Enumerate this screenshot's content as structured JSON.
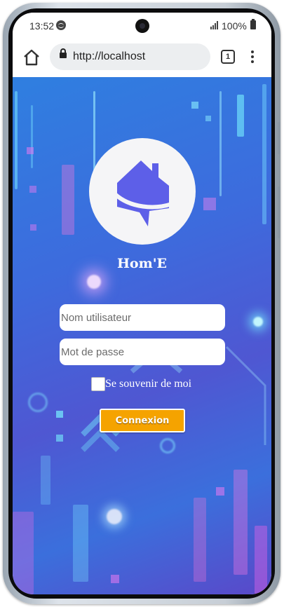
{
  "status_bar": {
    "time": "13:52",
    "battery": "100%",
    "icons": [
      "spotify-icon",
      "signal-icon",
      "battery-icon"
    ]
  },
  "browser": {
    "url": "http://localhost",
    "tab_count": "1",
    "icons": [
      "home-icon",
      "lock-icon",
      "tabs-icon",
      "menu-dots-icon"
    ]
  },
  "login": {
    "app_name": "Hom'E",
    "logo_icon": "house-chat-logo-icon",
    "username_placeholder": "Nom utilisateur",
    "password_placeholder": "Mot de passe",
    "remember_label": "Se souvenir de moi",
    "remember_checked": false,
    "submit_label": "Connexion"
  },
  "colors": {
    "background_gradient": [
      "#2f7fe0",
      "#4f57d2",
      "#5a48c9"
    ],
    "logo_purple": "#5d5fe8",
    "button": "#f5a300",
    "text_light": "#ffffff"
  }
}
